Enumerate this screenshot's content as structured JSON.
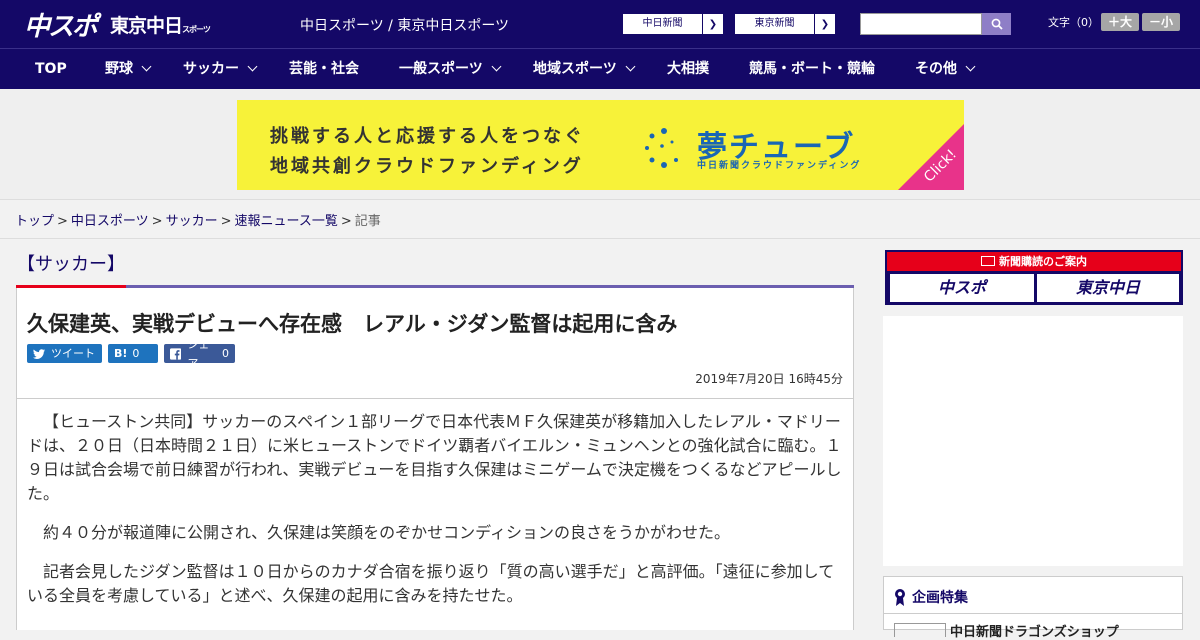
{
  "header": {
    "logo_main": "中スポ",
    "logo_sub": "東京中日",
    "logo_sub_small": "スポーツ",
    "site_name": "中日スポーツ / 東京中日スポーツ",
    "paper_links": [
      {
        "label": "中日新聞"
      },
      {
        "label": "東京新聞"
      }
    ],
    "search_placeholder": "",
    "font_label": "文字（0）",
    "font_larger": "＋大",
    "font_smaller": "－小"
  },
  "nav": {
    "items": [
      {
        "label": "TOP",
        "has_menu": false
      },
      {
        "label": "野球",
        "has_menu": true
      },
      {
        "label": "サッカー",
        "has_menu": true
      },
      {
        "label": "芸能・社会",
        "has_menu": false
      },
      {
        "label": "一般スポーツ",
        "has_menu": true
      },
      {
        "label": "地域スポーツ",
        "has_menu": true
      },
      {
        "label": "大相撲",
        "has_menu": false
      },
      {
        "label": "競馬・ボート・競輪",
        "has_menu": false
      },
      {
        "label": "その他",
        "has_menu": true
      }
    ]
  },
  "banner": {
    "line1": "挑戦する人と応援する人をつなぐ",
    "line2": "地域共創クラウドファンディング",
    "brand": "夢チューブ",
    "brand_sub": "中日新聞クラウドファンディング",
    "click": "Click!",
    "colors": {
      "background": "#f7f239",
      "brand": "#1a66b4",
      "corner": "#e8338a"
    }
  },
  "breadcrumb": {
    "items": [
      "トップ",
      "中日スポーツ",
      "サッカー",
      "速報ニュース一覧"
    ],
    "current": "記事",
    "separator": ">"
  },
  "article": {
    "category": "【サッカー】",
    "headline": "久保建英、実戦デビューへ存在感　レアル・ジダン監督は起用に含み",
    "share": {
      "tweet": "ツイート",
      "hatena_icon": "B!",
      "hatena_count": "0",
      "facebook_label": "シェア",
      "facebook_count": "0"
    },
    "date": "2019年7月20日 16時45分",
    "paragraphs": [
      "【ヒューストン共同】サッカーのスペイン１部リーグで日本代表ＭＦ久保建英が移籍加入したレアル・マドリードは、２０日（日本時間２１日）に米ヒューストンでドイツ覇者バイエルン・ミュンヘンとの強化試合に臨む。１９日は試合会場で前日練習が行われ、実戦デビューを目指す久保建はミニゲームで決定機をつくるなどアピールした。",
      "約４０分が報道陣に公開され、久保建は笑顔をのぞかせコンディションの良さをうかがわせた。",
      "記者会見したジダン監督は１０日からのカナダ合宿を振り返り「質の高い選手だ」と高評価。「遠征に参加している全員を考慮している」と述べ、久保建の起用に含みを持たせた。"
    ]
  },
  "sidebar": {
    "subscribe_title": "新聞購読のご案内",
    "subscribe_buttons": [
      "中スポ",
      "東京中日"
    ],
    "feature_title": "企画特集",
    "feature_item": "中日新聞ドラゴンズショップ"
  },
  "colors": {
    "header_bg": "#140867",
    "accent_red": "#e6001a",
    "accent_purple": "#6c5fb0",
    "twitter": "#1e73be",
    "facebook": "#3b5998"
  }
}
